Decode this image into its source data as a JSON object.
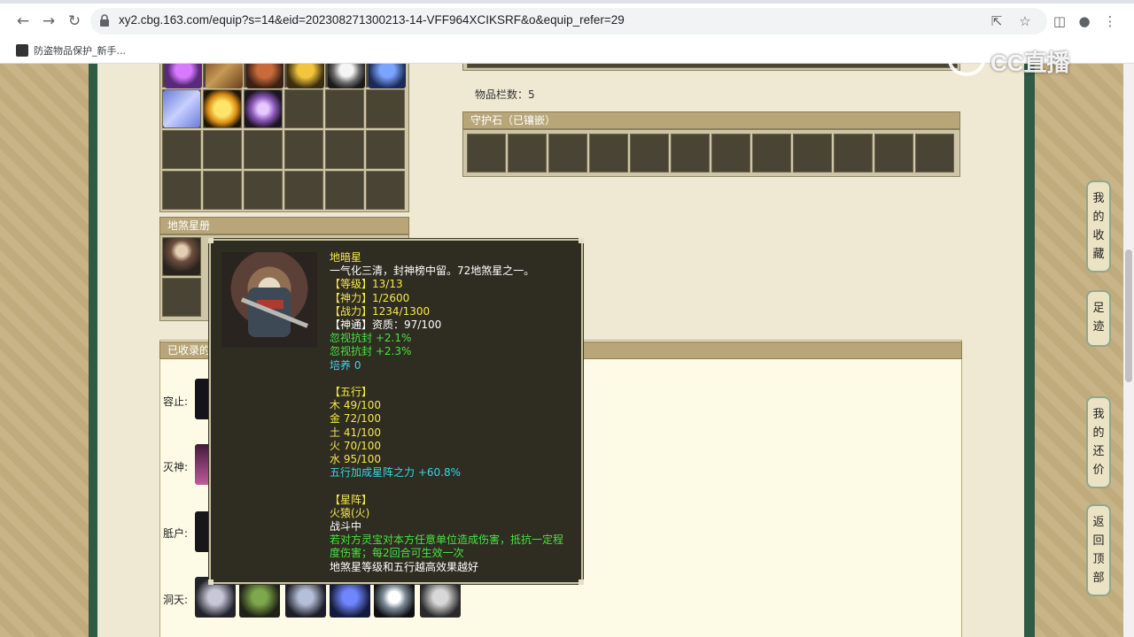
{
  "browser": {
    "url": "xy2.cbg.163.com/equip?s=14&eid=202308271300213-14-VFF964XCIKSRF&o&equip_refer=29",
    "bookmark_label": "防盗物品保护_新手..."
  },
  "watermark": {
    "text": "CC直播"
  },
  "page": {
    "item_count_label": "物品栏数：5",
    "guard_stone_header": "守护石（已镶嵌）",
    "star_book_header": "地煞星册",
    "collected_header": "已收录的",
    "rows": [
      {
        "label": "容止:"
      },
      {
        "label": "灭神:"
      },
      {
        "label": "胝户:"
      },
      {
        "label": "洞天:"
      }
    ]
  },
  "side_nav": {
    "favorites": [
      "我",
      "的",
      "收",
      "藏"
    ],
    "history": [
      "足",
      "迹"
    ],
    "bargain": [
      "我",
      "的",
      "还",
      "价"
    ],
    "top": [
      "返",
      "回",
      "顶",
      "部"
    ]
  },
  "tooltip": {
    "lines": [
      {
        "text": "地暗星",
        "color": "#f5e94a"
      },
      {
        "text": "一气化三清，封神榜中留。72地煞星之一。",
        "color": "#ffffff"
      },
      {
        "text": "【等级】13/13",
        "color": "#f5e94a"
      },
      {
        "text": "【神力】1/2600",
        "color": "#f5e94a"
      },
      {
        "text": "【战力】1234/1300",
        "color": "#f5e94a"
      },
      {
        "text": "【神通】资质：97/100",
        "color": "#ffffff"
      },
      {
        "text": "忽视抗封 +2.1%",
        "color": "#46e63c"
      },
      {
        "text": "忽视抗封 +2.3%",
        "color": "#46e63c"
      },
      {
        "text": "培养 0",
        "color": "#37d8e4"
      },
      {
        "text": "",
        "color": "#ffffff"
      },
      {
        "text": "【五行】",
        "color": "#f5e94a"
      },
      {
        "text": "木 49/100",
        "color": "#f5e94a"
      },
      {
        "text": "金 72/100",
        "color": "#f5e94a"
      },
      {
        "text": "土 41/100",
        "color": "#f5e94a"
      },
      {
        "text": "火 70/100",
        "color": "#f5e94a"
      },
      {
        "text": "水 95/100",
        "color": "#f5e94a"
      },
      {
        "text": "五行加成星阵之力 +60.8%",
        "color": "#37d8e4"
      },
      {
        "text": "",
        "color": "#ffffff"
      },
      {
        "text": "【星阵】",
        "color": "#f5e94a"
      },
      {
        "text": "火猿(火)",
        "color": "#f5e94a"
      },
      {
        "text": "战斗中",
        "color": "#ffffff"
      },
      {
        "text": "若对方灵宝对本方任意单位造成伤害，抵抗一定程",
        "color": "#46e63c"
      },
      {
        "text": "度伤害；每2回合可生效一次",
        "color": "#46e63c"
      },
      {
        "text": "地煞星等级和五行越高效果越好",
        "color": "#ffffff"
      }
    ]
  }
}
